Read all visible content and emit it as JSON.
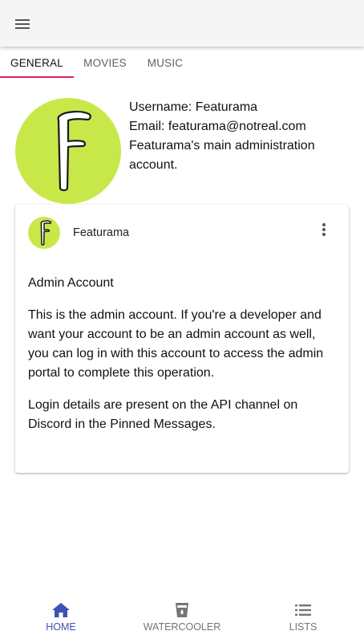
{
  "appbar": {
    "menu_icon": "menu-icon"
  },
  "tabs": [
    {
      "label": "GENERAL",
      "active": true
    },
    {
      "label": "MOVIES",
      "active": false
    },
    {
      "label": "MUSIC",
      "active": false
    }
  ],
  "profile": {
    "avatar_letter": "F",
    "username_line": "Username: Featurama",
    "email_line": "Email: featurama@notreal.com",
    "description": "Featurama's main administration account."
  },
  "card": {
    "author": "Featurama",
    "avatar_letter": "F",
    "more_icon": "more-vertical-icon",
    "title": "Admin Account",
    "paragraphs": [
      "This is the admin account. If you're a developer and want your account to be an admin account as well, you can log in with this account to access the admin portal to complete this operation.",
      "Login details are present on the API channel on Discord in the Pinned Messages."
    ]
  },
  "bottom_nav": [
    {
      "label": "HOME",
      "icon": "home-icon",
      "active": true
    },
    {
      "label": "WATERCOOLER",
      "icon": "watercooler-icon",
      "active": false
    },
    {
      "label": "LISTS",
      "icon": "list-icon",
      "active": false
    }
  ],
  "colors": {
    "avatar_bg": "#c8e84a",
    "tab_indicator": "#e0245e",
    "nav_active": "#3f51b5",
    "appbar_bg": "#f5f5f5"
  }
}
